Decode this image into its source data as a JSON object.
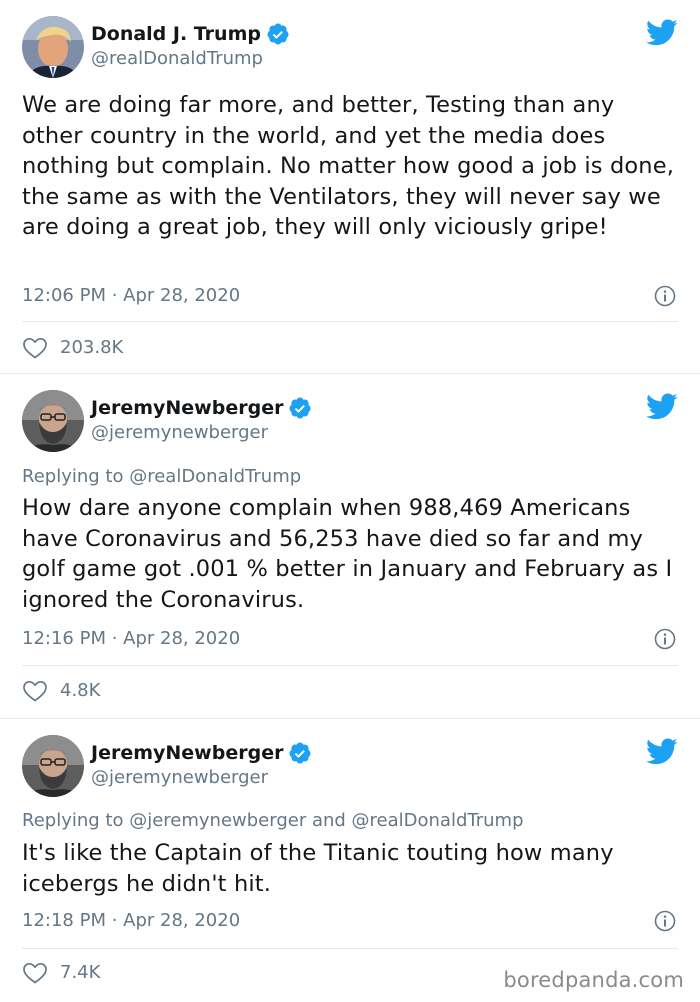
{
  "colors": {
    "text": "#14171a",
    "secondary": "#657786",
    "twitter_blue": "#1da1f2",
    "divider": "#e1e8ed"
  },
  "tweets": [
    {
      "author_name": "Donald J. Trump",
      "handle": "@realDonaldTrump",
      "verified": true,
      "avatar_icon": "avatar-trump",
      "replying_to": null,
      "text": "We are doing far more, and better, Testing than any other country in the world, and yet the media does nothing but complain. No matter how good a job is done, the same as with the Ventilators, they will never say we are doing a great job, they will only viciously gripe!",
      "timestamp": "12:06 PM · Apr 28, 2020",
      "likes": "203.8K"
    },
    {
      "author_name": "JeremyNewberger",
      "handle": "@jeremynewberger",
      "verified": true,
      "avatar_icon": "avatar-jeremy",
      "replying_prefix": "Replying to ",
      "replying_to": "@realDonaldTrump",
      "text": "How dare anyone complain when 988,469 Americans have Coronavirus and 56,253 have died so far and my golf game got .001 % better in January and February as I ignored the Coronavirus.",
      "timestamp": "12:16 PM · Apr 28, 2020",
      "likes": "4.8K"
    },
    {
      "author_name": "JeremyNewberger",
      "handle": "@jeremynewberger",
      "verified": true,
      "avatar_icon": "avatar-jeremy",
      "replying_prefix": "Replying to ",
      "replying_to": "@jeremynewberger and @realDonaldTrump",
      "text": "It's like the Captain of the Titanic touting how many icebergs he didn't hit.",
      "timestamp": "12:18 PM · Apr 28, 2020",
      "likes": "7.4K"
    }
  ],
  "watermark": "boredpanda.com"
}
